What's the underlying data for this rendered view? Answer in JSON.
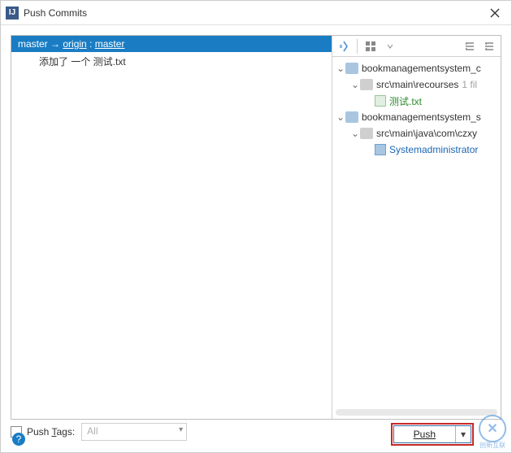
{
  "window": {
    "title": "Push Commits"
  },
  "left": {
    "branch_local": "master",
    "arrow": " → ",
    "remote_name": "origin",
    "colon": " : ",
    "branch_remote": "master",
    "commit": "添加了 一个 测试.txt"
  },
  "tree": {
    "module1": "bookmanagementsystem_c",
    "path1": "src\\main\\recourses",
    "hint1": "1 fil",
    "file1": "测试.txt",
    "module2": "bookmanagementsystem_s",
    "path2": "src\\main\\java\\com\\czxy",
    "file2": "Systemadministrator"
  },
  "bottom": {
    "push_tags_label": "Push Tags:",
    "tags_mode": "All",
    "push_label": "Push"
  },
  "watermark": {
    "brand": "创新互联"
  }
}
